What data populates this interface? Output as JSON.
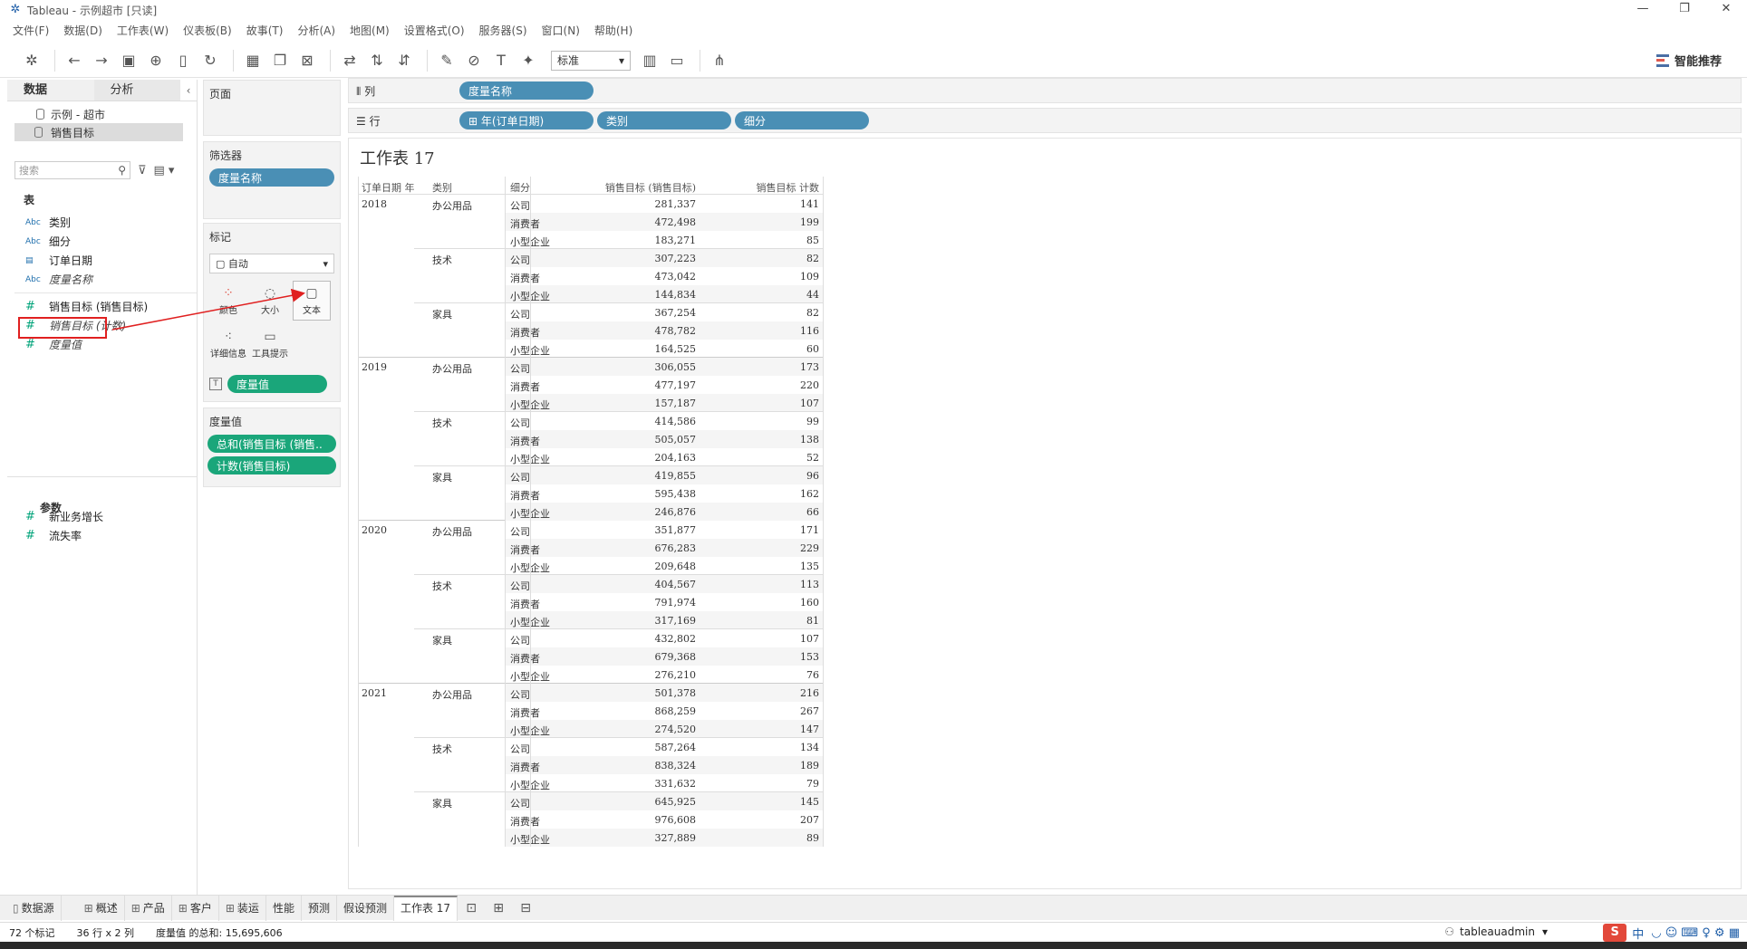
{
  "window": {
    "title": "Tableau - 示例超市 [只读]",
    "controls": [
      "—",
      "❐",
      "✕"
    ]
  },
  "menu": [
    "文件(F)",
    "数据(D)",
    "工作表(W)",
    "仪表板(B)",
    "故事(T)",
    "分析(A)",
    "地图(M)",
    "设置格式(O)",
    "服务器(S)",
    "窗口(N)",
    "帮助(H)"
  ],
  "toolbar": {
    "fit_select": "标准",
    "smart_label": "智能推荐"
  },
  "datapane": {
    "tab_data": "数据",
    "tab_analysis": "分析",
    "datasources": [
      "示例 - 超市",
      "销售目标"
    ],
    "search_placeholder": "搜索",
    "tables_header": "表",
    "dimensions": [
      {
        "type": "Abc",
        "name": "类别"
      },
      {
        "type": "Abc",
        "name": "细分"
      },
      {
        "type": "date",
        "name": "订单日期"
      },
      {
        "type": "Abc",
        "name": "度量名称"
      }
    ],
    "measures": [
      {
        "name": "销售目标 (销售目标)"
      },
      {
        "name": "销售目标 (计数)"
      },
      {
        "name": "度量值"
      }
    ],
    "params_header": "参数",
    "params": [
      "新业务增长",
      "流失率"
    ]
  },
  "cards": {
    "pages_title": "页面",
    "filters_title": "筛选器",
    "filter_pill": "度量名称",
    "marks_title": "标记",
    "marks_type": "自动",
    "mark_buttons": [
      "颜色",
      "大小",
      "文本",
      "详细信息",
      "工具提示"
    ],
    "marks_pill": "度量值",
    "measure_values_title": "度量值",
    "mv_pills": [
      "总和(销售目标 (销售..",
      "计数(销售目标)"
    ]
  },
  "shelves": {
    "columns_label": "列",
    "columns_pills": [
      "度量名称"
    ],
    "rows_label": "行",
    "rows_pills": [
      "⊞ 年(订单日期)",
      "类别",
      "细分"
    ]
  },
  "sheet": {
    "title": "工作表 17",
    "headers": [
      "订单日期 年",
      "类别",
      "细分",
      "销售目标 (销售目标)",
      "销售目标 计数"
    ],
    "rows": [
      [
        "2018",
        "办公用品",
        "公司",
        "281,337",
        "141"
      ],
      [
        "",
        "",
        "消费者",
        "472,498",
        "199"
      ],
      [
        "",
        "",
        "小型企业",
        "183,271",
        "85"
      ],
      [
        "",
        "技术",
        "公司",
        "307,223",
        "82"
      ],
      [
        "",
        "",
        "消费者",
        "473,042",
        "109"
      ],
      [
        "",
        "",
        "小型企业",
        "144,834",
        "44"
      ],
      [
        "",
        "家具",
        "公司",
        "367,254",
        "82"
      ],
      [
        "",
        "",
        "消费者",
        "478,782",
        "116"
      ],
      [
        "",
        "",
        "小型企业",
        "164,525",
        "60"
      ],
      [
        "2019",
        "办公用品",
        "公司",
        "306,055",
        "173"
      ],
      [
        "",
        "",
        "消费者",
        "477,197",
        "220"
      ],
      [
        "",
        "",
        "小型企业",
        "157,187",
        "107"
      ],
      [
        "",
        "技术",
        "公司",
        "414,586",
        "99"
      ],
      [
        "",
        "",
        "消费者",
        "505,057",
        "138"
      ],
      [
        "",
        "",
        "小型企业",
        "204,163",
        "52"
      ],
      [
        "",
        "家具",
        "公司",
        "419,855",
        "96"
      ],
      [
        "",
        "",
        "消费者",
        "595,438",
        "162"
      ],
      [
        "",
        "",
        "小型企业",
        "246,876",
        "66"
      ],
      [
        "2020",
        "办公用品",
        "公司",
        "351,877",
        "171"
      ],
      [
        "",
        "",
        "消费者",
        "676,283",
        "229"
      ],
      [
        "",
        "",
        "小型企业",
        "209,648",
        "135"
      ],
      [
        "",
        "技术",
        "公司",
        "404,567",
        "113"
      ],
      [
        "",
        "",
        "消费者",
        "791,974",
        "160"
      ],
      [
        "",
        "",
        "小型企业",
        "317,169",
        "81"
      ],
      [
        "",
        "家具",
        "公司",
        "432,802",
        "107"
      ],
      [
        "",
        "",
        "消费者",
        "679,368",
        "153"
      ],
      [
        "",
        "",
        "小型企业",
        "276,210",
        "76"
      ],
      [
        "2021",
        "办公用品",
        "公司",
        "501,378",
        "216"
      ],
      [
        "",
        "",
        "消费者",
        "868,259",
        "267"
      ],
      [
        "",
        "",
        "小型企业",
        "274,520",
        "147"
      ],
      [
        "",
        "技术",
        "公司",
        "587,264",
        "134"
      ],
      [
        "",
        "",
        "消费者",
        "838,324",
        "189"
      ],
      [
        "",
        "",
        "小型企业",
        "331,632",
        "79"
      ],
      [
        "",
        "家具",
        "公司",
        "645,925",
        "145"
      ],
      [
        "",
        "",
        "消费者",
        "976,608",
        "207"
      ],
      [
        "",
        "",
        "小型企业",
        "327,889",
        "89"
      ]
    ]
  },
  "bottom_tabs": [
    "数据源",
    "概述",
    "产品",
    "客户",
    "装运",
    "性能",
    "预测",
    "假设预测",
    "工作表 17"
  ],
  "status": {
    "marks": "72 个标记",
    "dims": "36 行 x 2 列",
    "sum": "度量值 的总和: 15,695,606",
    "user": "tableauadmin",
    "ime": "中"
  },
  "colors": {
    "dimension_pill": "#4a8fb5",
    "measure_pill": "#1aa67a",
    "annotation": "#e02020"
  }
}
